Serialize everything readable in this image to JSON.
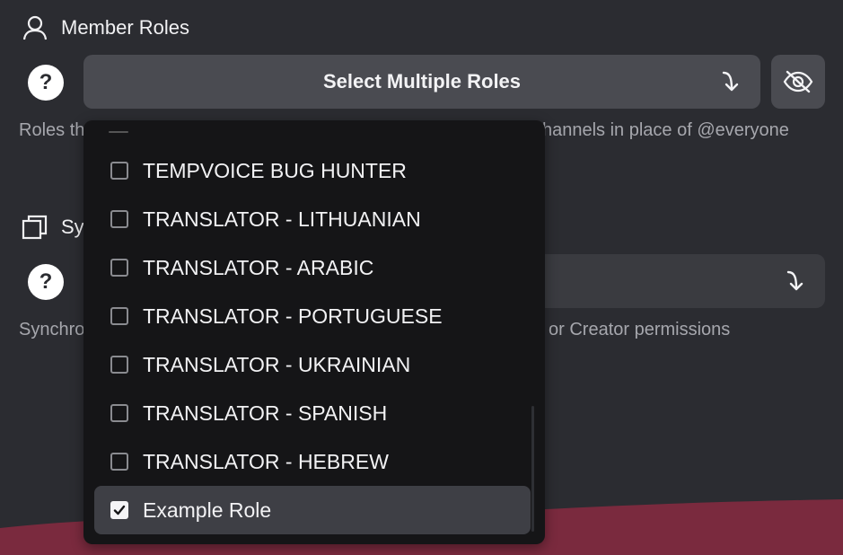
{
  "member_roles": {
    "title": "Member Roles",
    "select_label": "Select Multiple Roles",
    "help_left": "Roles th",
    "help_right": "hannels in place of @everyone"
  },
  "sync_section": {
    "title_partial": "Sy",
    "help_left": "Synchro",
    "help_right": "or Creator permissions"
  },
  "dropdown": {
    "options": [
      {
        "label": "TEMPVOICE BUG HUNTER",
        "checked": false
      },
      {
        "label": "TRANSLATOR - LITHUANIAN",
        "checked": false
      },
      {
        "label": "TRANSLATOR - ARABIC",
        "checked": false
      },
      {
        "label": "TRANSLATOR - PORTUGUESE",
        "checked": false
      },
      {
        "label": "TRANSLATOR - UKRAINIAN",
        "checked": false
      },
      {
        "label": "TRANSLATOR - SPANISH",
        "checked": false
      },
      {
        "label": "TRANSLATOR - HEBREW",
        "checked": false
      },
      {
        "label": "Example Role",
        "checked": true
      }
    ]
  },
  "icons": {
    "section1": "user-icon",
    "section2": "copy-icon",
    "help": "question-icon",
    "arrow": "arrow-curve-down-icon",
    "eye": "eye-off-icon",
    "check": "checkmark-icon"
  },
  "colors": {
    "background": "#2b2c31",
    "field": "#4a4b51",
    "dropdown": "#151517",
    "selected_row": "#3e3f45",
    "wave": "#7a2a3e"
  }
}
